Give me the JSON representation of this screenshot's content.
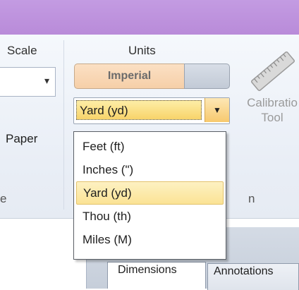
{
  "scale_group": {
    "label": "Scale",
    "paper_label": "Paper",
    "footer_fragment": "e"
  },
  "units_group": {
    "label": "Units",
    "toggle": {
      "imperial_label": "Imperial",
      "selected": "Imperial"
    },
    "combo_value": "Yard (yd)",
    "footer_fragment": "n"
  },
  "calibration": {
    "label_line1": "Calibratio",
    "label_line2": "Tool"
  },
  "dropdown": {
    "items": [
      "Feet (ft)",
      "Inches (\")",
      "Yard (yd)",
      "Thou (th)",
      "Miles (M)"
    ],
    "selected": "Yard (yd)"
  },
  "tabs": [
    "Dimensions",
    "Annotations"
  ],
  "colors": {
    "title_bar": "#b98bd9",
    "selection": "#fbe395",
    "imperial_active": "#f6cfa8"
  }
}
